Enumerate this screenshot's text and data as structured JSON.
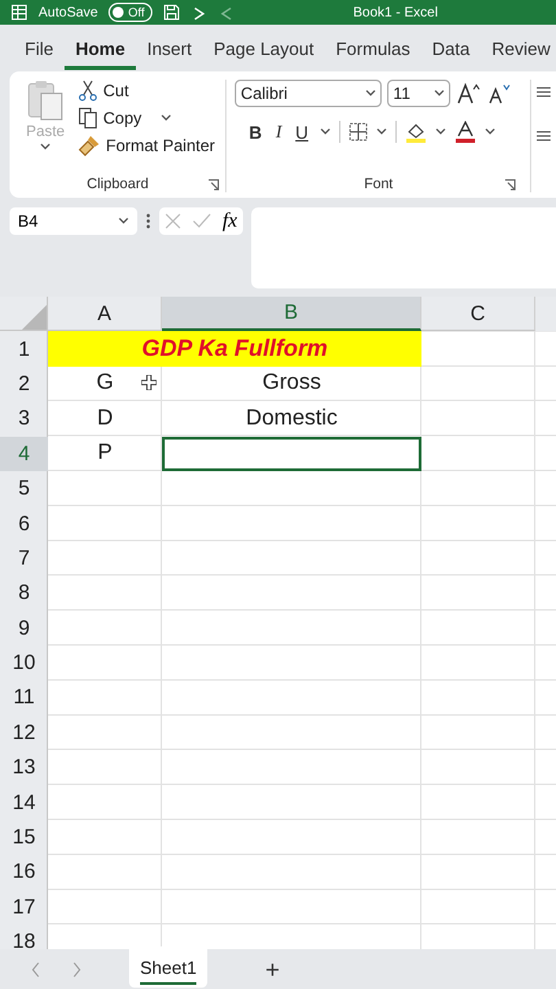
{
  "title_bar": {
    "autosave_label": "AutoSave",
    "autosave_toggle": "Off",
    "autosave_on": false,
    "document_title": "Book1 - Excel"
  },
  "ribbon_tabs": [
    {
      "label": "File",
      "selected": false
    },
    {
      "label": "Home",
      "selected": true
    },
    {
      "label": "Insert",
      "selected": false
    },
    {
      "label": "Page Layout",
      "selected": false
    },
    {
      "label": "Formulas",
      "selected": false
    },
    {
      "label": "Data",
      "selected": false
    },
    {
      "label": "Review",
      "selected": false
    }
  ],
  "clipboard": {
    "paste": "Paste",
    "paste_disabled": true,
    "cut": "Cut",
    "copy": "Copy",
    "format_painter": "Format Painter",
    "group_label": "Clipboard"
  },
  "font": {
    "name": "Calibri",
    "size": "11",
    "bold": "B",
    "italic": "I",
    "underline": "U",
    "group_label": "Font"
  },
  "formula_bar": {
    "name_box": "B4",
    "fx": "fx"
  },
  "columns": [
    {
      "label": "A",
      "selected": false
    },
    {
      "label": "B",
      "selected": true
    },
    {
      "label": "C",
      "selected": false
    }
  ],
  "rows": [
    {
      "label": "1",
      "selected": false,
      "kind": "title",
      "cells": [
        "GDP Ka Fullform"
      ]
    },
    {
      "label": "2",
      "selected": false,
      "kind": "plain",
      "cells": [
        "G",
        "Gross"
      ]
    },
    {
      "label": "3",
      "selected": false,
      "kind": "plain",
      "cells": [
        "D",
        "Domestic"
      ]
    },
    {
      "label": "4",
      "selected": true,
      "kind": "plain",
      "cells": [
        "P"
      ]
    },
    {
      "label": "5",
      "selected": false,
      "kind": "plain"
    },
    {
      "label": "6",
      "selected": false,
      "kind": "plain"
    },
    {
      "label": "7",
      "selected": false,
      "kind": "plain"
    },
    {
      "label": "8",
      "selected": false,
      "kind": "plain"
    },
    {
      "label": "9",
      "selected": false,
      "kind": "plain"
    },
    {
      "label": "10",
      "selected": false,
      "kind": "plain"
    },
    {
      "label": "11",
      "selected": false,
      "kind": "plain"
    },
    {
      "label": "12",
      "selected": false,
      "kind": "plain"
    },
    {
      "label": "13",
      "selected": false,
      "kind": "plain"
    },
    {
      "label": "14",
      "selected": false,
      "kind": "plain"
    },
    {
      "label": "15",
      "selected": false,
      "kind": "plain"
    },
    {
      "label": "16",
      "selected": false,
      "kind": "plain"
    },
    {
      "label": "17",
      "selected": false,
      "kind": "plain"
    },
    {
      "label": "18",
      "selected": false,
      "kind": "plain"
    }
  ],
  "sheet_tabs": [
    {
      "label": "Sheet1",
      "selected": true
    }
  ],
  "add_sheet": "+"
}
